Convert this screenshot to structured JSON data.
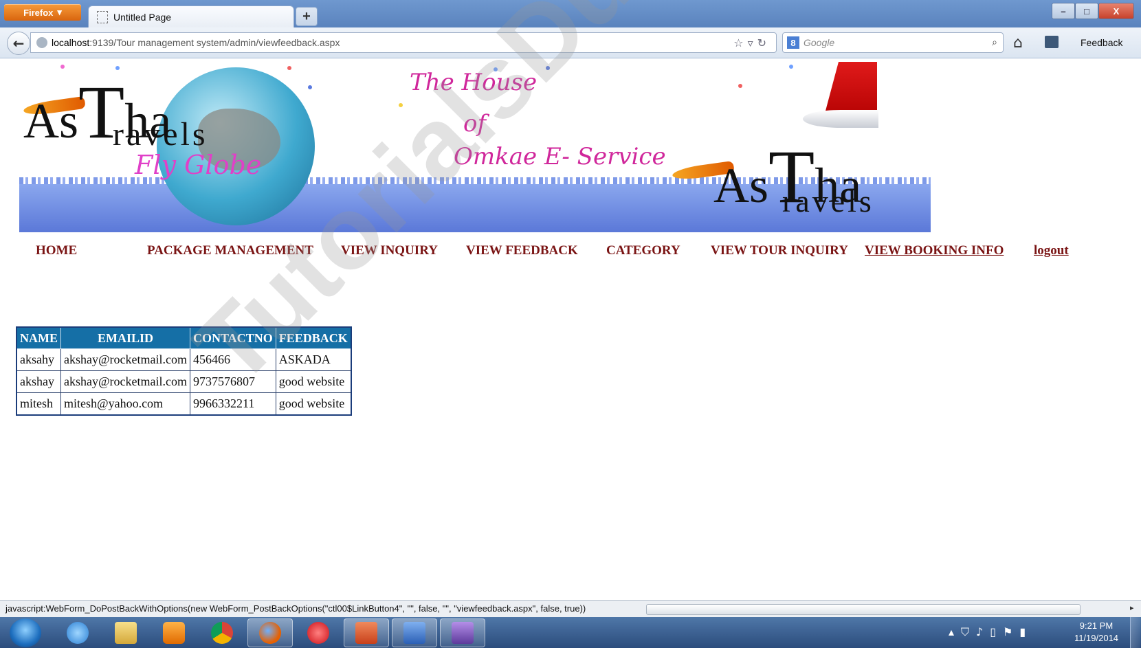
{
  "browser": {
    "menu_label": "Firefox",
    "tab_title": "Untitled Page",
    "url_host": "localhost",
    "url_rest": ":9139/Tour management system/admin/viewfeedback.aspx",
    "search_placeholder": "Google",
    "feedback_label": "Feedback",
    "minimize_glyph": "–",
    "restore_glyph": "□",
    "close_glyph": "X"
  },
  "banner": {
    "logo_letters_1": "As",
    "logo_big_T": "T",
    "logo_ha": "ha",
    "logo_travels": "ravels",
    "slogan": "Fly Globe",
    "house_line1": "The House",
    "house_line2": "of",
    "house_line3": "Omkae E- Service"
  },
  "nav": {
    "items": [
      {
        "label": "HOME"
      },
      {
        "label": "PACKAGE MANAGEMENT"
      },
      {
        "label": "VIEW INQUIRY"
      },
      {
        "label": "VIEW FEEDBACK"
      },
      {
        "label": "CATEGORY"
      },
      {
        "label": "VIEW TOUR INQUIRY"
      },
      {
        "label": "VIEW  BOOKING  INFO"
      },
      {
        "label": "logout"
      }
    ]
  },
  "feedback_table": {
    "headers": [
      "NAME",
      "EMAILID",
      "CONTACTNO",
      "FEEDBACK"
    ],
    "rows": [
      [
        "aksahy",
        "akshay@rocketmail.com",
        "456466",
        "ASKADA"
      ],
      [
        "akshay",
        "akshay@rocketmail.com",
        "9737576807",
        "good website"
      ],
      [
        "mitesh",
        "mitesh@yahoo.com",
        "9966332211",
        "good website"
      ]
    ]
  },
  "watermark": "TutorialsDuniya.com",
  "status_bar": {
    "text": "javascript:WebForm_DoPostBackWithOptions(new WebForm_PostBackOptions(\"ctl00$LinkButton4\", \"\", false, \"\", \"viewfeedback.aspx\", false, true))"
  },
  "taskbar": {
    "time": "9:21 PM",
    "date": "11/19/2014"
  },
  "colors": {
    "nav_link": "#7a1414",
    "table_header": "#156fa6",
    "titlebar": "#5a83bd"
  }
}
